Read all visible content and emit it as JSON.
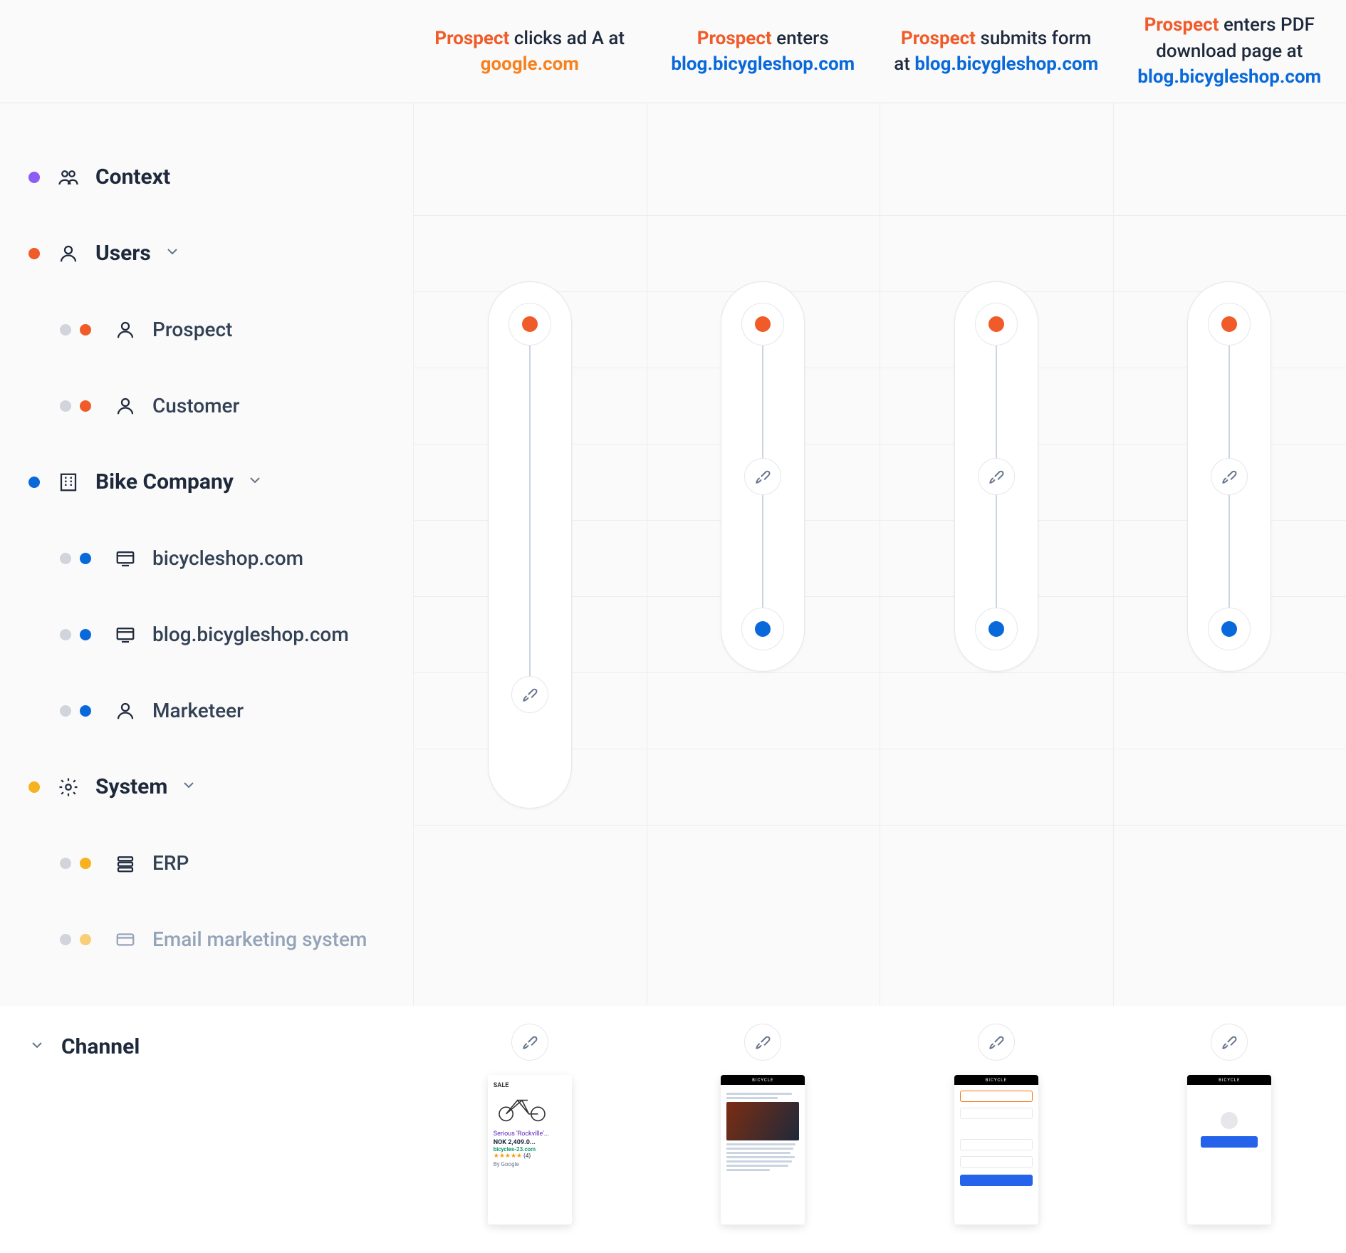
{
  "header_steps": [
    {
      "prefix": "Prospect",
      "mid": " clicks ad A at ",
      "link": "google.com",
      "link_style": "orange"
    },
    {
      "prefix": "Prospect",
      "mid": " enters ",
      "link": "blog.bicygleshop.com",
      "link_style": "blue"
    },
    {
      "prefix": "Prospect",
      "mid": " submits form at ",
      "link": "blog.bicygleshop.com",
      "link_style": "blue"
    },
    {
      "prefix": "Prospect",
      "mid": " enters PDF download page at ",
      "link": "blog.bicygleshop.com",
      "link_style": "blue"
    }
  ],
  "groups": {
    "context": {
      "label": "Context"
    },
    "users": {
      "label": "Users",
      "items": [
        {
          "label": "Prospect",
          "icon": "person",
          "dot_color": "orange"
        },
        {
          "label": "Customer",
          "icon": "person",
          "dot_color": "orange"
        }
      ]
    },
    "company": {
      "label": "Bike Company",
      "items": [
        {
          "label": "bicycleshop.com",
          "icon": "screen",
          "dot_color": "blue"
        },
        {
          "label": "blog.bicygleshop.com",
          "icon": "screen",
          "dot_color": "blue"
        },
        {
          "label": "Marketeer",
          "icon": "person",
          "dot_color": "blue"
        }
      ]
    },
    "system": {
      "label": "System",
      "items": [
        {
          "label": "ERP",
          "icon": "stack",
          "dot_color": "yellow"
        },
        {
          "label": "Email marketing system",
          "icon": "card",
          "dot_color": "yellow",
          "muted": true
        }
      ]
    }
  },
  "channel": {
    "label": "Channel"
  },
  "ad_mock": {
    "sale": "SALE",
    "title": "Serious 'Rockville'...",
    "price": "NOK 2,409.0...",
    "domain": "bicycles-23.com",
    "stars": "★★★★★",
    "rating_count": "(4)",
    "by": "By Google"
  },
  "blog_mock": {
    "brand": "BICYCLE"
  },
  "form_mock": {
    "brand": "BICYCLE"
  },
  "download_mock": {
    "brand": "BICYCLE"
  }
}
